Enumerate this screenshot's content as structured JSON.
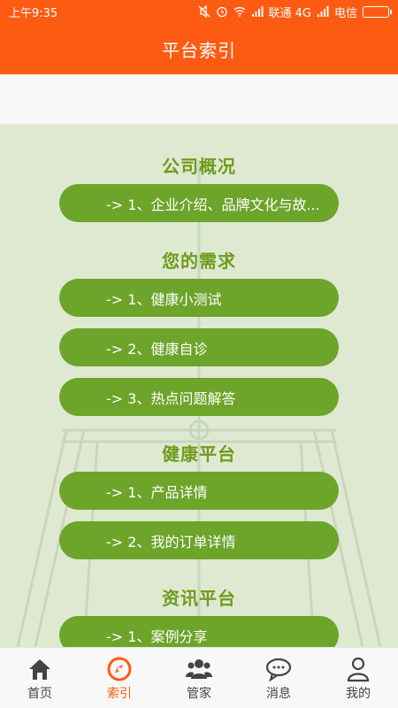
{
  "status": {
    "time": "上午9:35",
    "carrier1": "联通 4G",
    "carrier2": "电信"
  },
  "header": {
    "title": "平台索引"
  },
  "sections": [
    {
      "title": "公司概况",
      "items": [
        "-> 1、企业介绍、品牌文化与故..."
      ]
    },
    {
      "title": "您的需求",
      "items": [
        "-> 1、健康小测试",
        "-> 2、健康自诊",
        "-> 3、热点问题解答"
      ]
    },
    {
      "title": "健康平台",
      "items": [
        "-> 1、产品详情",
        "-> 2、我的订单详情"
      ]
    },
    {
      "title": "资讯平台",
      "items": [
        "-> 1、案例分享"
      ]
    }
  ],
  "tabs": [
    {
      "label": "首页",
      "icon": "home-icon"
    },
    {
      "label": "索引",
      "icon": "compass-icon",
      "active": true
    },
    {
      "label": "管家",
      "icon": "people-icon"
    },
    {
      "label": "消息",
      "icon": "chat-bubble-icon"
    },
    {
      "label": "我的",
      "icon": "user-icon"
    }
  ],
  "colors": {
    "accent": "#fe5b12",
    "button": "#6da42a",
    "section_title": "#6e9c1c",
    "background": "#dfe9d2"
  }
}
